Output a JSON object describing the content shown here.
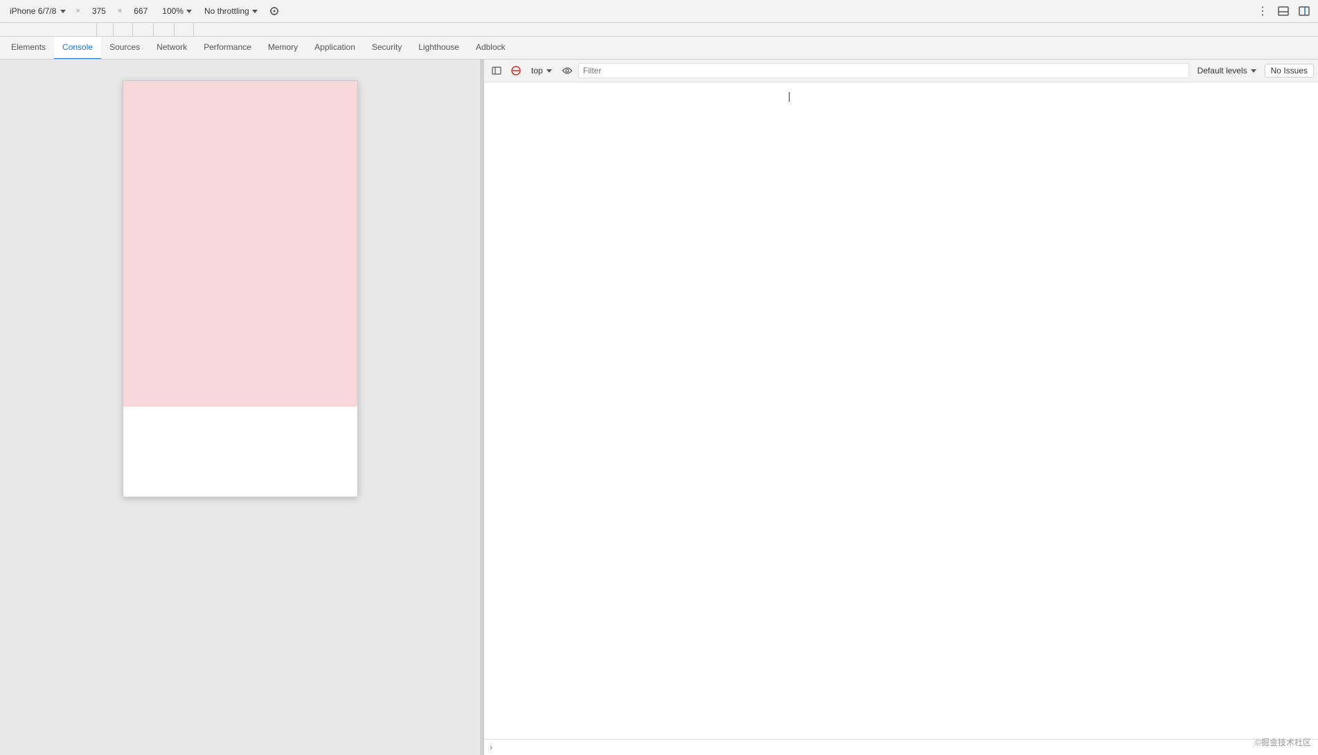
{
  "toolbar": {
    "device_label": "iPhone 6/7/8",
    "width_value": "375",
    "height_value": "667",
    "cross_label": "×",
    "zoom_label": "100%",
    "throttle_label": "No throttling",
    "more_label": "⋮",
    "screenshot_icon": "📷",
    "rotate_icon": "⤢"
  },
  "tabs": [
    {
      "label": "Elements",
      "active": false
    },
    {
      "label": "Console",
      "active": true
    },
    {
      "label": "Sources",
      "active": false
    },
    {
      "label": "Network",
      "active": false
    },
    {
      "label": "Performance",
      "active": false
    },
    {
      "label": "Memory",
      "active": false
    },
    {
      "label": "Application",
      "active": false
    },
    {
      "label": "Security",
      "active": false
    },
    {
      "label": "Lighthouse",
      "active": false
    },
    {
      "label": "Adblock",
      "active": false
    }
  ],
  "console": {
    "top_label": "top",
    "filter_placeholder": "Filter",
    "default_levels_label": "Default levels",
    "no_issues_label": "No Issues"
  },
  "watermark": {
    "text": "©掘金技术社区"
  }
}
